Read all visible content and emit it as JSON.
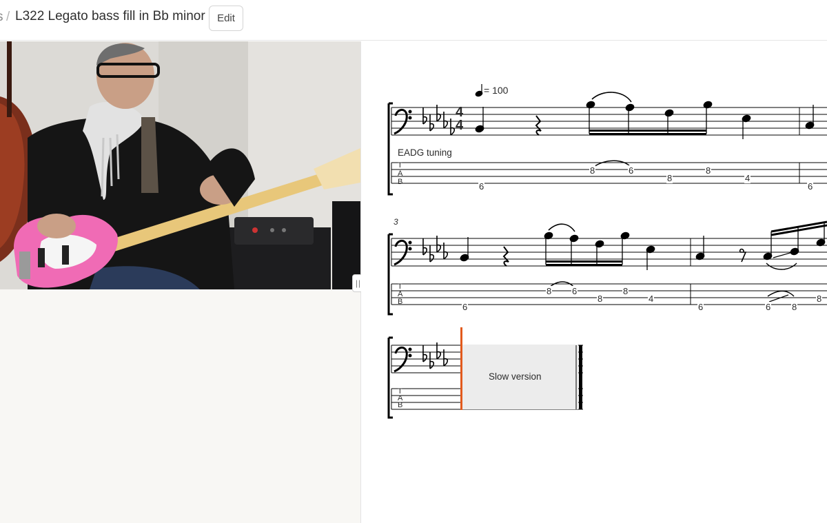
{
  "header": {
    "breadcrumb_prev": "s",
    "breadcrumb_separator": "/",
    "title": "L322 Legato bass fill in Bb minor",
    "edit_label": "Edit"
  },
  "player": {
    "resize_handle": "|||"
  },
  "score": {
    "tempo_value": "= 100",
    "tuning": "EADG tuning",
    "time_sig_top": "4",
    "time_sig_bottom": "4",
    "measure_number_2": "3",
    "section_label": "Slow version",
    "tab_clef": [
      "T",
      "A",
      "B"
    ],
    "system1_tab": [
      "6",
      "8",
      "6",
      "8",
      "8",
      "4",
      "6"
    ],
    "system2_tab": [
      "6",
      "8",
      "6",
      "8",
      "8",
      "4",
      "6",
      "6",
      "8",
      "8"
    ],
    "cursor_color": "#e25a1c"
  }
}
